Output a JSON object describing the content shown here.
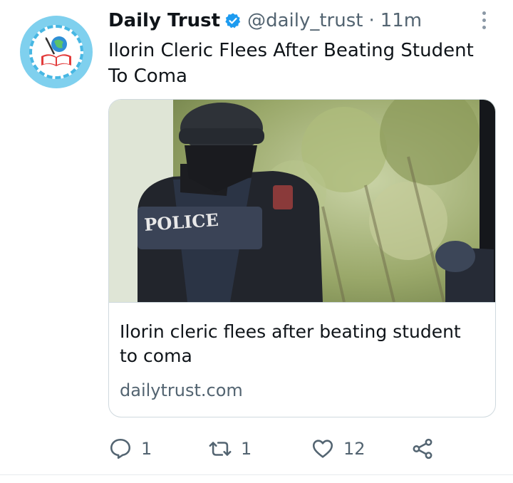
{
  "tweet": {
    "author_name": "Daily Trust",
    "handle": "@daily_trust",
    "separator": "·",
    "time": "11m",
    "text": "Ilorin Cleric Flees After Beating Student To Coma"
  },
  "card": {
    "image_text": "POLICE",
    "title": "Ilorin cleric flees after beating student to coma",
    "domain": "dailytrust.com"
  },
  "actions": {
    "reply_count": "1",
    "retweet_count": "1",
    "like_count": "12"
  },
  "icons": [
    "verified-badge-icon",
    "more-options-icon",
    "reply-icon",
    "retweet-icon",
    "like-icon",
    "share-icon"
  ],
  "colors": {
    "verified": "#1d9bf0",
    "secondary_text": "#536471",
    "border": "#cfd9de",
    "avatar_bg": "#7fd0ee"
  }
}
